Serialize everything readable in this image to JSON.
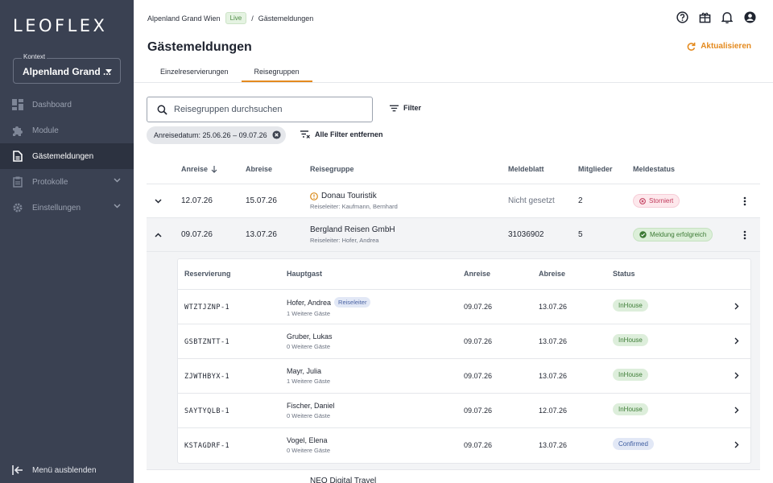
{
  "sidebar": {
    "logo": "LEOFLEX",
    "context_label": "Kontext",
    "context_value": "Alpenland Grand ...",
    "items": [
      {
        "label": "Dashboard",
        "icon": "dashboard-icon"
      },
      {
        "label": "Module",
        "icon": "puzzle-icon"
      },
      {
        "label": "Gästemeldungen",
        "icon": "document-icon"
      },
      {
        "label": "Protokolle",
        "icon": "clipboard-icon"
      },
      {
        "label": "Einstellungen",
        "icon": "gear-icon"
      }
    ],
    "collapse_label": "Menü ausblenden"
  },
  "header": {
    "breadcrumb_hotel": "Alpenland Grand Wien",
    "live_badge": "Live",
    "breadcrumb_sep": "/",
    "breadcrumb_page": "Gästemeldungen",
    "title": "Gästemeldungen",
    "refresh_label": "Aktualisieren",
    "tabs": [
      "Einzelreservierungen",
      "Reisegruppen"
    ]
  },
  "search": {
    "placeholder": "Reisegruppen durchsuchen"
  },
  "filter_label": "Filter",
  "active_filter": "Anreisedatum: 25.06.26 – 09.07.26",
  "clear_filters_label": "Alle Filter entfernen",
  "table": {
    "headers": {
      "anreise": "Anreise",
      "abreise": "Abreise",
      "gruppe": "Reisegruppe",
      "meldeblatt": "Meldeblatt",
      "mitglieder": "Mitglieder",
      "status": "Meldestatus"
    },
    "rows": [
      {
        "anreise": "12.07.26",
        "abreise": "15.07.26",
        "gruppe": "Donau Touristik",
        "leiter": "Reiseleiter: Kaufmann, Bernhard",
        "meldeblatt": "Nicht gesetzt",
        "mitglieder": "2",
        "status": "Storniert"
      },
      {
        "anreise": "09.07.26",
        "abreise": "13.07.26",
        "gruppe": "Bergland Reisen GmbH",
        "leiter": "Reiseleiter: Hofer, Andrea",
        "meldeblatt": "31036902",
        "mitglieder": "5",
        "status": "Meldung erfolgreich"
      },
      {
        "gruppe": "NEO Digital Travel"
      }
    ]
  },
  "subtable": {
    "headers": {
      "reservierung": "Reservierung",
      "hauptgast": "Hauptgast",
      "anreise": "Anreise",
      "abreise": "Abreise",
      "status": "Status"
    },
    "role_badge": "Reiseleiter",
    "rows": [
      {
        "res": "WTZTJZNP-1",
        "gast": "Hofer, Andrea",
        "weitere": "1 Weitere Gäste",
        "anreise": "09.07.26",
        "abreise": "13.07.26",
        "status": "InHouse"
      },
      {
        "res": "GSBTZNTT-1",
        "gast": "Gruber, Lukas",
        "weitere": "0 Weitere Gäste",
        "anreise": "09.07.26",
        "abreise": "13.07.26",
        "status": "InHouse"
      },
      {
        "res": "ZJWTHBYX-1",
        "gast": "Mayr, Julia",
        "weitere": "1 Weitere Gäste",
        "anreise": "09.07.26",
        "abreise": "13.07.26",
        "status": "InHouse"
      },
      {
        "res": "SAYTYQLB-1",
        "gast": "Fischer, Daniel",
        "weitere": "0 Weitere Gäste",
        "anreise": "09.07.26",
        "abreise": "12.07.26",
        "status": "InHouse"
      },
      {
        "res": "KSTAGDRF-1",
        "gast": "Vogel, Elena",
        "weitere": "0 Weitere Gäste",
        "anreise": "09.07.26",
        "abreise": "13.07.26",
        "status": "Confirmed"
      }
    ]
  },
  "colors": {
    "accent": "#e48a1e",
    "sidebar": "#3a4152"
  }
}
